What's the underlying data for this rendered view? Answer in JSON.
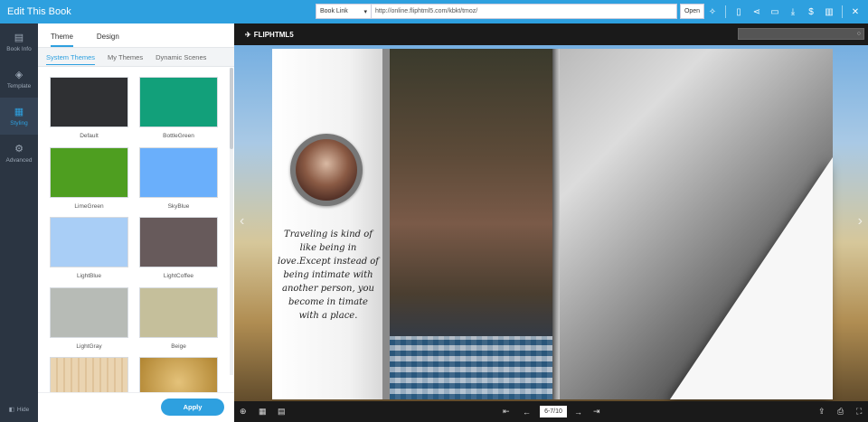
{
  "app": {
    "title": "Edit This Book"
  },
  "topbar": {
    "link_type": "Book Link",
    "link_url": "http://online.fliphtml5.com/kbkt/tmoz/",
    "open_label": "Open"
  },
  "rail": {
    "items": [
      {
        "label": "Book Info",
        "icon": "book-info-icon"
      },
      {
        "label": "Template",
        "icon": "template-icon"
      },
      {
        "label": "Styling",
        "icon": "styling-icon",
        "active": true
      },
      {
        "label": "Advanced",
        "icon": "advanced-icon"
      }
    ],
    "hide_label": "Hide"
  },
  "panel": {
    "tabs": [
      "Theme",
      "Design"
    ],
    "subtabs": [
      "System Themes",
      "My Themes",
      "Dynamic Scenes"
    ],
    "themes": [
      {
        "name": "Default",
        "color": "#2f3033"
      },
      {
        "name": "BottleGreen",
        "color": "#12a07a"
      },
      {
        "name": "LimeGreen",
        "color": "#4e9e20"
      },
      {
        "name": "SkyBlue",
        "color": "#6aaffb"
      },
      {
        "name": "LightBlue",
        "color": "#a9cef6"
      },
      {
        "name": "LightCoffee",
        "color": "#675a5b"
      },
      {
        "name": "LightGray",
        "color": "#b7bbb6"
      },
      {
        "name": "Beige",
        "color": "#c5bf9b"
      },
      {
        "name": "",
        "color": "#e8cfa8"
      },
      {
        "name": "",
        "color": "#c69a4a"
      }
    ],
    "apply_label": "Apply"
  },
  "preview": {
    "logo": "FLIPHTML5",
    "page_indicator": "6-7/10",
    "quote": "Traveling is kind of like being in love.Except instead of being intimate with another person, you become in timate with a place."
  }
}
